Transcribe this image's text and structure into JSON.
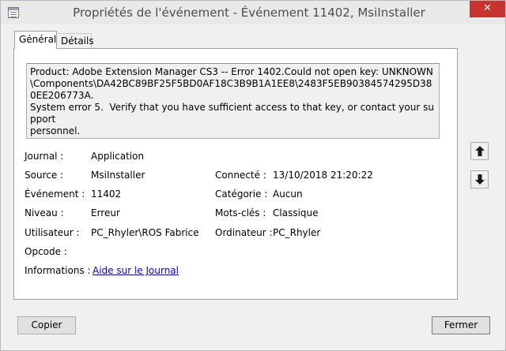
{
  "window": {
    "title": "Propriétés de l'événement - Événement 11402, MsiInstaller",
    "close_glyph": "✕"
  },
  "tabs": [
    {
      "label": "Général",
      "selected": true
    },
    {
      "label": "Détails",
      "selected": false
    }
  ],
  "description": "Product: Adobe Extension Manager CS3 -- Error 1402.Could not open key: UNKNOWN\n\\Components\\DA42BC89BF25F5BD0AF18C3B9B1A1EE8\\2483F5EB90384574295D380EE206773A.\nSystem error 5.  Verify that you have sufficient access to that key, or contact your support\npersonnel.",
  "fields": {
    "journal": {
      "label": "Journal :",
      "value": "Application"
    },
    "source": {
      "label": "Source :",
      "value": "MsiInstaller"
    },
    "evenement": {
      "label": "Événement :",
      "value": "11402"
    },
    "niveau": {
      "label": "Niveau :",
      "value": "Erreur"
    },
    "utilisateur": {
      "label": "Utilisateur :",
      "value": "PC_Rhyler\\ROS Fabrice"
    },
    "opcode": {
      "label": "Opcode :",
      "value": ""
    },
    "informations": {
      "label": "Informations :",
      "value": "Aide sur le Journal"
    },
    "connecte": {
      "label": "Connecté :",
      "value": "13/10/2018 21:20:22"
    },
    "categorie": {
      "label": "Catégorie :",
      "value": "Aucun"
    },
    "mots_cles": {
      "label": "Mots-clés :",
      "value": "Classique"
    },
    "ordinateur": {
      "label": "Ordinateur :",
      "value": "PC_Rhyler"
    }
  },
  "nav": {
    "up_icon": "arrow-up-icon",
    "down_icon": "arrow-down-icon"
  },
  "buttons": {
    "copy": "Copier",
    "close": "Fermer"
  }
}
